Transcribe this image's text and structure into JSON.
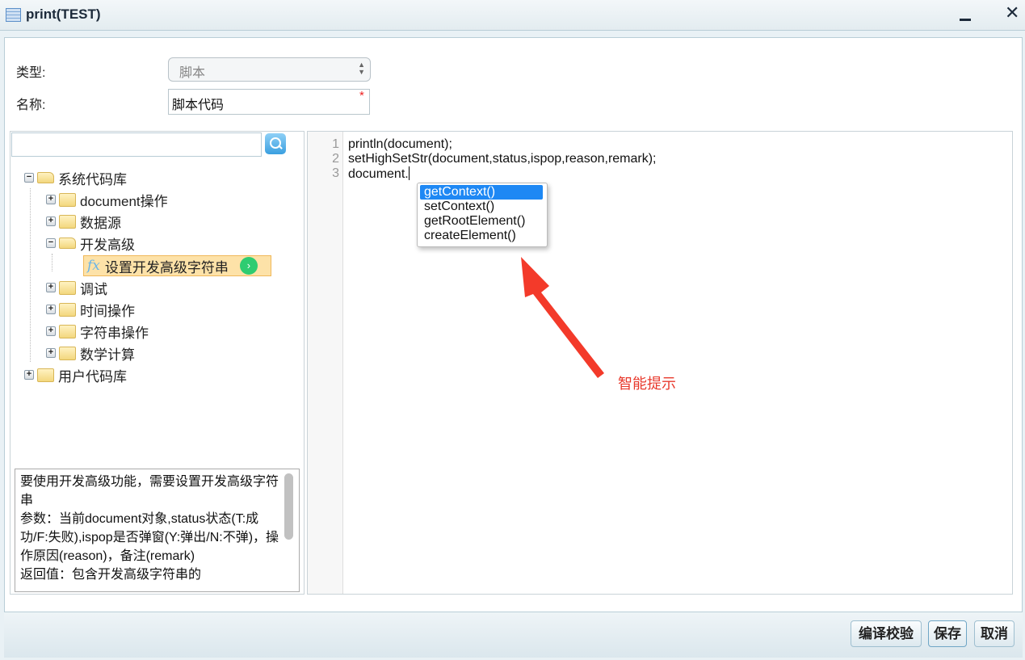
{
  "window": {
    "title": "print(TEST)",
    "minimize": "minimize",
    "close": "✕"
  },
  "form": {
    "type_label": "类型:",
    "type_value": "脚本",
    "name_label": "名称:",
    "name_value": "脚本代码",
    "required_mark": "*"
  },
  "search": {
    "value": "",
    "placeholder": ""
  },
  "tree": {
    "root": "系统代码库",
    "children": [
      "document操作",
      "数据源",
      "开发高级",
      "调试",
      "时间操作",
      "字符串操作",
      "数学计算"
    ],
    "selected_function": "设置开发高级字符串",
    "user_root": "用户代码库"
  },
  "description": [
    "要使用开发高级功能，需要设置开发高级字符串",
    "参数：当前document对象,status状态(T:成功/F:失败),ispop是否弹窗(Y:弹出/N:不弹)，操作原因(reason)，备注(remark)",
    "返回值：包含开发高级字符串的"
  ],
  "editor": {
    "line_numbers": [
      "1",
      "2",
      "3"
    ],
    "lines": [
      "println(document);",
      "setHighSetStr(document,status,ispop,reason,remark);",
      "document."
    ],
    "autocomplete": [
      "getContext()",
      "setContext()",
      "getRootElement()",
      "createElement()"
    ]
  },
  "annotation": {
    "text": "智能提示",
    "color": "#e8392c"
  },
  "buttons": {
    "compile": "编译校验",
    "save": "保存",
    "cancel": "取消"
  }
}
